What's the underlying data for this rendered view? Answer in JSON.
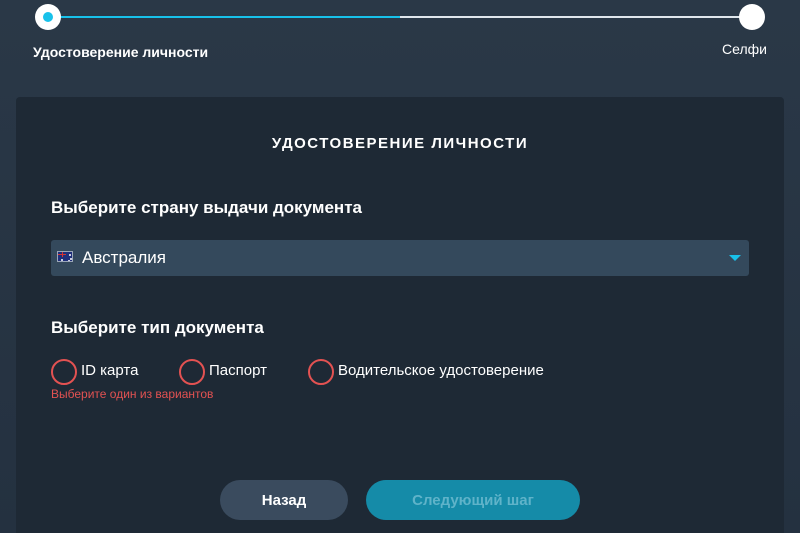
{
  "stepper": {
    "steps": [
      {
        "label": "Удостоверение личности",
        "state": "active"
      },
      {
        "label": "Селфи",
        "state": "pending"
      }
    ],
    "progress": 0.5,
    "accent_color": "#18c1ea"
  },
  "card": {
    "title": "УДОСТОВЕРЕНИЕ ЛИЧНОСТИ",
    "country_section": {
      "label": "Выберите страну выдачи документа",
      "selected_value": "Австралия",
      "flag_icon": "australia-flag-icon"
    },
    "doctype_section": {
      "label": "Выберите тип документа",
      "options": [
        {
          "label": "ID карта",
          "selected": false
        },
        {
          "label": "Паспорт",
          "selected": false
        },
        {
          "label": "Водительское удостоверение",
          "selected": false
        }
      ],
      "error": "Выберите один из вариантов",
      "error_color": "#e35252"
    },
    "buttons": {
      "back_label": "Назад",
      "next_label": "Следующий шаг"
    }
  }
}
